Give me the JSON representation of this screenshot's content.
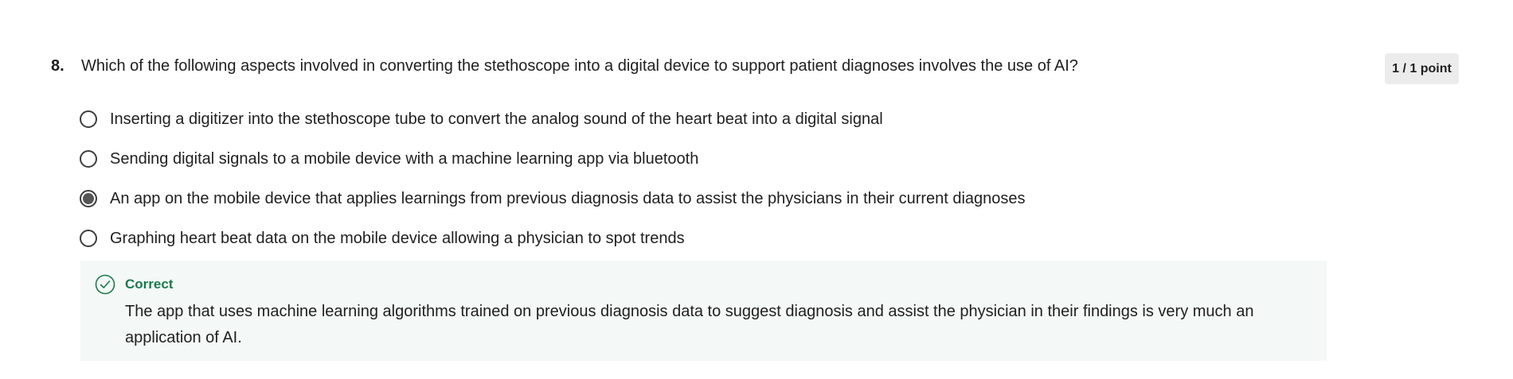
{
  "question": {
    "number": "8.",
    "text": "Which of the following aspects involved in converting the stethoscope into a digital device to support patient diagnoses involves the use of AI?",
    "points": "1 / 1 point"
  },
  "options": [
    {
      "label": "Inserting a digitizer into the stethoscope tube to convert the analog sound of the heart beat into a digital signal",
      "selected": false
    },
    {
      "label": "Sending digital signals to a mobile device with a machine learning app via bluetooth",
      "selected": false
    },
    {
      "label": "An app on the mobile device that applies learnings from previous diagnosis data to assist the physicians in their current diagnoses",
      "selected": true
    },
    {
      "label": "Graphing heart beat data on the mobile device allowing a physician to spot trends",
      "selected": false
    }
  ],
  "feedback": {
    "status": "Correct",
    "text": "The app that uses machine learning algorithms trained on previous diagnosis data to suggest diagnosis and assist the physician in their findings is very much an application of AI."
  },
  "colors": {
    "correct_green": "#1a7a4e",
    "feedback_bg": "#f4f8f6",
    "badge_bg": "#ececec"
  }
}
